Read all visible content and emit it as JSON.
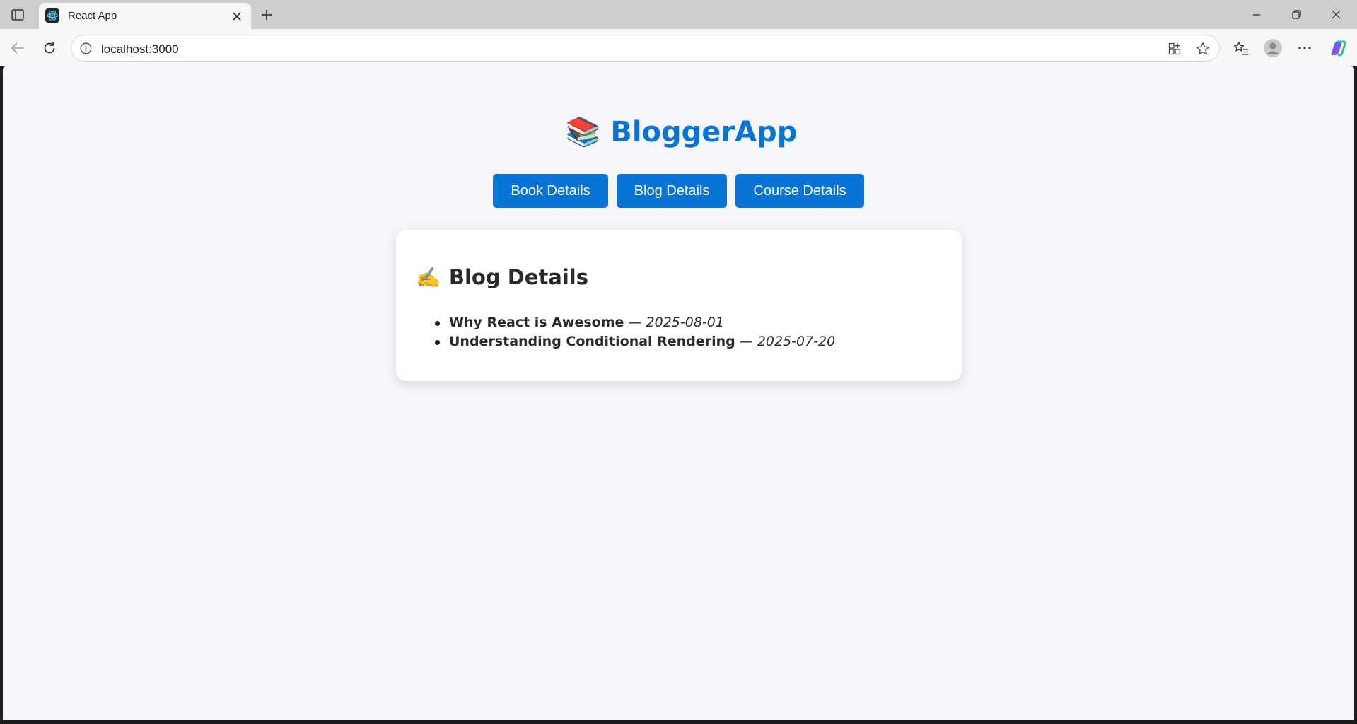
{
  "browser": {
    "tab_title": "React App",
    "url": "localhost:3000"
  },
  "app": {
    "title": "BloggerApp",
    "title_emoji": "📚",
    "nav": [
      {
        "label": "Book Details"
      },
      {
        "label": "Blog Details"
      },
      {
        "label": "Course Details"
      }
    ]
  },
  "section": {
    "heading": "Blog Details",
    "heading_emoji": "✍️",
    "posts": [
      {
        "title": "Why React is Awesome",
        "separator": " — ",
        "date": "2025-08-01"
      },
      {
        "title": "Understanding Conditional Rendering",
        "separator": " — ",
        "date": "2025-07-20"
      }
    ]
  },
  "colors": {
    "accent": "#0a74d6",
    "page_bg": "#f4f6f9",
    "card_bg": "#ffffff"
  }
}
